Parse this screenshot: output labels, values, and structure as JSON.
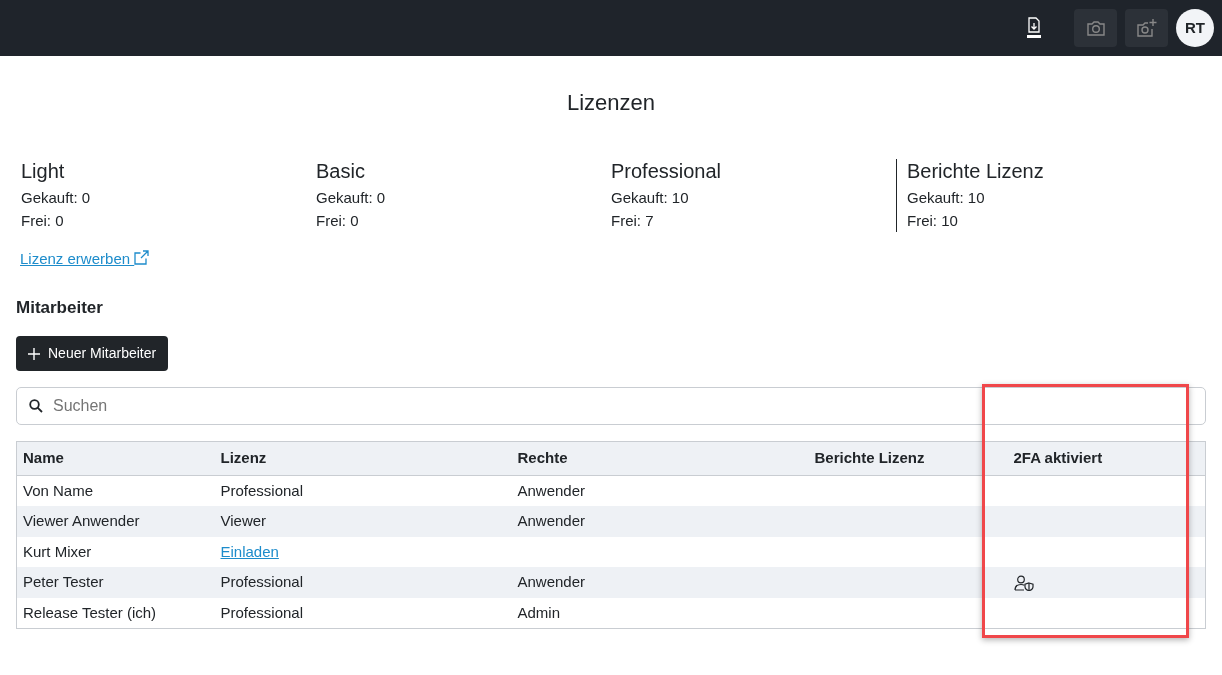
{
  "topbar": {
    "avatar_initials": "RT"
  },
  "page_title": "Lizenzen",
  "licenses": [
    {
      "name": "Light",
      "bought": "Gekauft: 0",
      "free": "Frei: 0",
      "separated": false
    },
    {
      "name": "Basic",
      "bought": "Gekauft: 0",
      "free": "Frei: 0",
      "separated": false
    },
    {
      "name": "Professional",
      "bought": "Gekauft: 10",
      "free": "Frei: 7",
      "separated": false
    },
    {
      "name": "Berichte Lizenz",
      "bought": "Gekauft: 10",
      "free": "Frei: 10",
      "separated": true
    }
  ],
  "buy_link": "Lizenz erwerben",
  "section_title": "Mitarbeiter",
  "new_button": "Neuer Mitarbeiter",
  "search": {
    "placeholder": "Suchen"
  },
  "table": {
    "columns": [
      "Name",
      "Lizenz",
      "Rechte",
      "Berichte Lizenz",
      "2FA aktiviert"
    ],
    "rows": [
      {
        "name": "Von Name",
        "license": "Professional",
        "license_link": false,
        "rights": "Anwender",
        "twofa": false
      },
      {
        "name": "Viewer Anwender",
        "license": "Viewer",
        "license_link": false,
        "rights": "Anwender",
        "twofa": false
      },
      {
        "name": "Kurt Mixer",
        "license": "Einladen",
        "license_link": true,
        "twofa": false
      },
      {
        "name": "Peter Tester",
        "license": "Professional",
        "license_link": false,
        "rights": "Anwender",
        "twofa": true
      },
      {
        "name": "Release Tester (ich)",
        "license": "Professional",
        "license_link": false,
        "rights": "Admin",
        "twofa": false
      }
    ]
  }
}
